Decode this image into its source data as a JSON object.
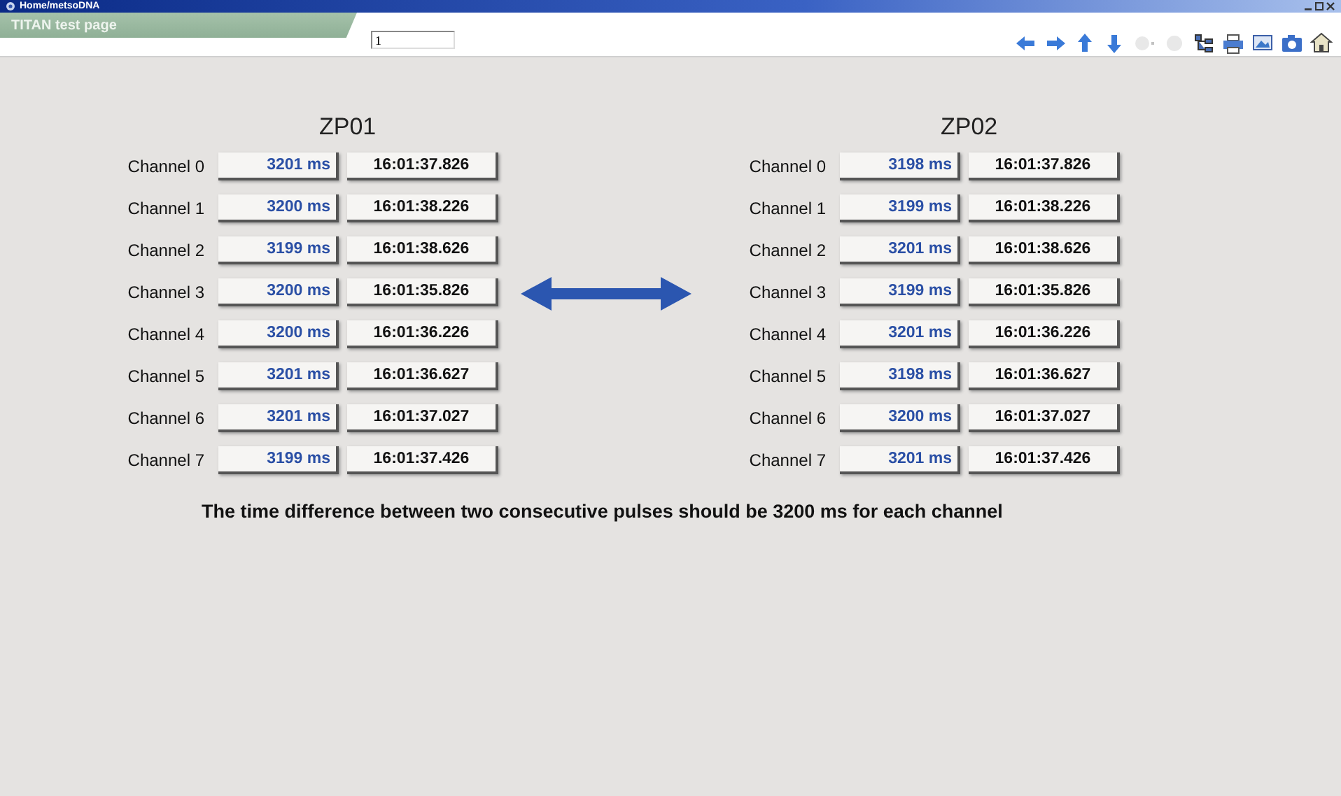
{
  "window": {
    "title": "Home/metsoDNA"
  },
  "header": {
    "page_title": "TITAN test page",
    "field_value": "1"
  },
  "toolbar": [
    {
      "kind": "left",
      "disabled": false
    },
    {
      "kind": "right",
      "disabled": false
    },
    {
      "kind": "up",
      "disabled": false
    },
    {
      "kind": "down",
      "disabled": false
    },
    {
      "kind": "dropdown",
      "disabled": true
    },
    {
      "kind": "circle",
      "disabled": true
    },
    {
      "kind": "tree",
      "disabled": false
    },
    {
      "kind": "printer",
      "disabled": false
    },
    {
      "kind": "image",
      "disabled": false
    },
    {
      "kind": "camera",
      "disabled": false
    },
    {
      "kind": "home",
      "disabled": false
    }
  ],
  "panels": [
    {
      "title": "ZP01",
      "channels": [
        {
          "label": "Channel 0",
          "interval": "3201 ms",
          "timestamp": "16:01:37.826"
        },
        {
          "label": "Channel 1",
          "interval": "3200 ms",
          "timestamp": "16:01:38.226"
        },
        {
          "label": "Channel 2",
          "interval": "3199 ms",
          "timestamp": "16:01:38.626"
        },
        {
          "label": "Channel 3",
          "interval": "3200 ms",
          "timestamp": "16:01:35.826"
        },
        {
          "label": "Channel 4",
          "interval": "3200 ms",
          "timestamp": "16:01:36.226"
        },
        {
          "label": "Channel 5",
          "interval": "3201 ms",
          "timestamp": "16:01:36.627"
        },
        {
          "label": "Channel 6",
          "interval": "3201 ms",
          "timestamp": "16:01:37.027"
        },
        {
          "label": "Channel 7",
          "interval": "3199 ms",
          "timestamp": "16:01:37.426"
        }
      ]
    },
    {
      "title": "ZP02",
      "channels": [
        {
          "label": "Channel 0",
          "interval": "3198 ms",
          "timestamp": "16:01:37.826"
        },
        {
          "label": "Channel 1",
          "interval": "3199 ms",
          "timestamp": "16:01:38.226"
        },
        {
          "label": "Channel 2",
          "interval": "3201 ms",
          "timestamp": "16:01:38.626"
        },
        {
          "label": "Channel 3",
          "interval": "3199 ms",
          "timestamp": "16:01:35.826"
        },
        {
          "label": "Channel 4",
          "interval": "3201 ms",
          "timestamp": "16:01:36.226"
        },
        {
          "label": "Channel 5",
          "interval": "3198 ms",
          "timestamp": "16:01:36.627"
        },
        {
          "label": "Channel 6",
          "interval": "3200 ms",
          "timestamp": "16:01:37.027"
        },
        {
          "label": "Channel 7",
          "interval": "3201 ms",
          "timestamp": "16:01:37.426"
        }
      ]
    }
  ],
  "note": "The time difference between two consecutive pulses should be 3200 ms for each channel"
}
